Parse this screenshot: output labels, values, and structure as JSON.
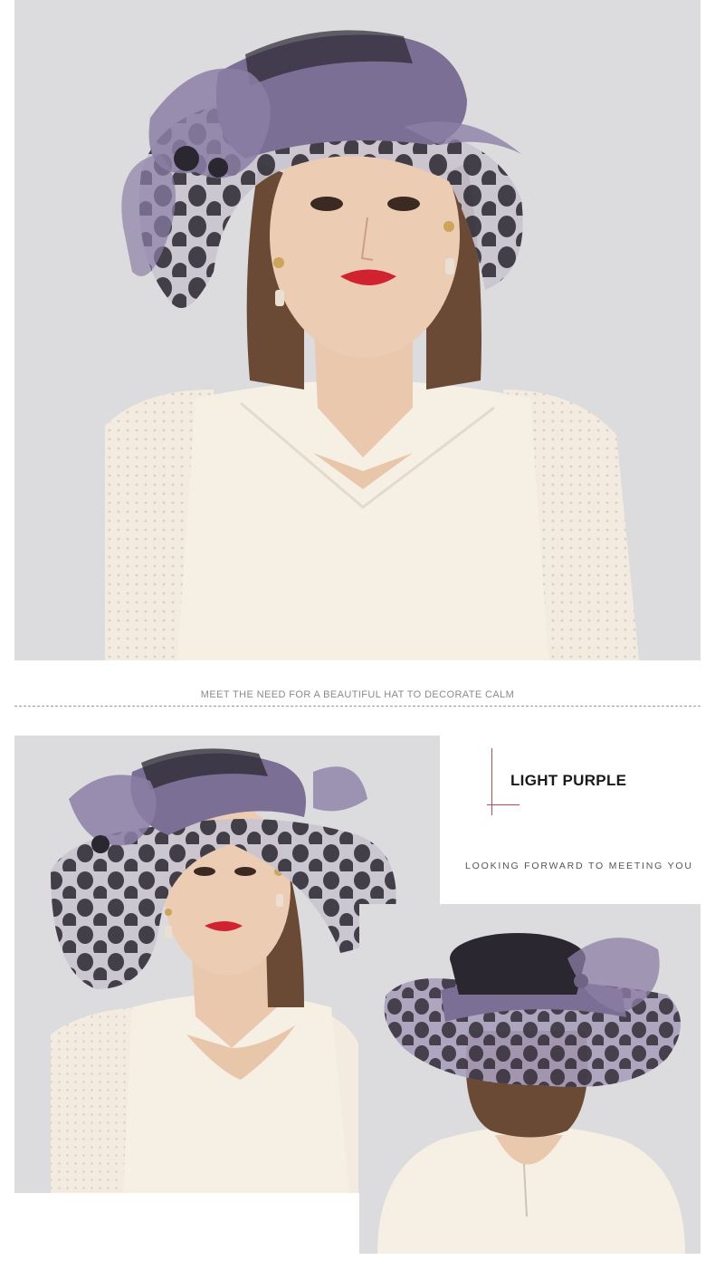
{
  "divider": {
    "caption": "MEET THE NEED FOR A BEAUTIFUL HAT TO DECORATE CALM"
  },
  "product": {
    "color_name": "LIGHT PURPLE",
    "tagline": "LOOKING FORWARD TO MEETING YOU"
  },
  "colors": {
    "hat_purple": "#8c7fa6",
    "hat_dark": "#2a2730",
    "dress_cream": "#f5eee3",
    "skin": "#e9c8ae",
    "hair": "#6b4a35",
    "accent_red": "#c44a4a",
    "background_gray": "#dcdcde"
  },
  "photos": {
    "hero": "model-front-hat-photo",
    "side": "model-side-hat-photo",
    "back": "model-back-hat-photo"
  }
}
